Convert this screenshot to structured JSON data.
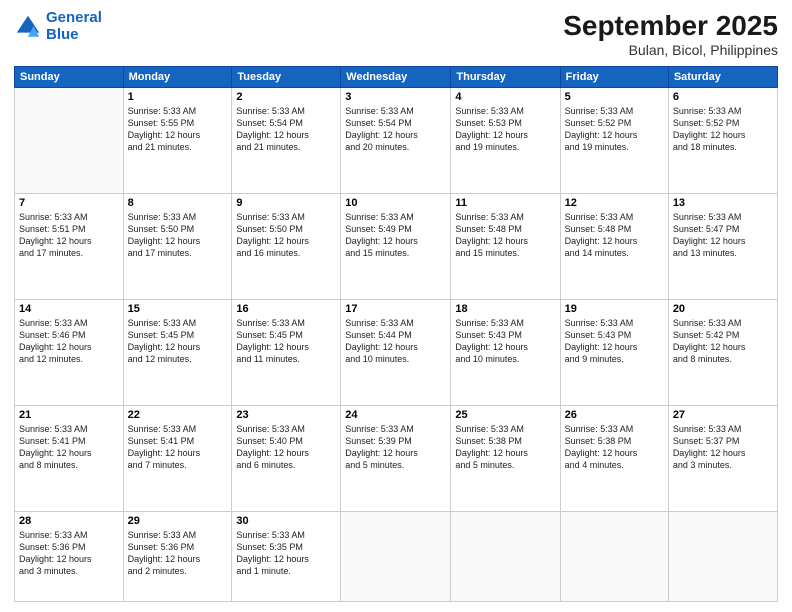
{
  "logo": {
    "line1": "General",
    "line2": "Blue"
  },
  "header": {
    "month": "September 2025",
    "location": "Bulan, Bicol, Philippines"
  },
  "weekdays": [
    "Sunday",
    "Monday",
    "Tuesday",
    "Wednesday",
    "Thursday",
    "Friday",
    "Saturday"
  ],
  "weeks": [
    [
      {
        "day": "",
        "text": ""
      },
      {
        "day": "1",
        "text": "Sunrise: 5:33 AM\nSunset: 5:55 PM\nDaylight: 12 hours\nand 21 minutes."
      },
      {
        "day": "2",
        "text": "Sunrise: 5:33 AM\nSunset: 5:54 PM\nDaylight: 12 hours\nand 21 minutes."
      },
      {
        "day": "3",
        "text": "Sunrise: 5:33 AM\nSunset: 5:54 PM\nDaylight: 12 hours\nand 20 minutes."
      },
      {
        "day": "4",
        "text": "Sunrise: 5:33 AM\nSunset: 5:53 PM\nDaylight: 12 hours\nand 19 minutes."
      },
      {
        "day": "5",
        "text": "Sunrise: 5:33 AM\nSunset: 5:52 PM\nDaylight: 12 hours\nand 19 minutes."
      },
      {
        "day": "6",
        "text": "Sunrise: 5:33 AM\nSunset: 5:52 PM\nDaylight: 12 hours\nand 18 minutes."
      }
    ],
    [
      {
        "day": "7",
        "text": "Sunrise: 5:33 AM\nSunset: 5:51 PM\nDaylight: 12 hours\nand 17 minutes."
      },
      {
        "day": "8",
        "text": "Sunrise: 5:33 AM\nSunset: 5:50 PM\nDaylight: 12 hours\nand 17 minutes."
      },
      {
        "day": "9",
        "text": "Sunrise: 5:33 AM\nSunset: 5:50 PM\nDaylight: 12 hours\nand 16 minutes."
      },
      {
        "day": "10",
        "text": "Sunrise: 5:33 AM\nSunset: 5:49 PM\nDaylight: 12 hours\nand 15 minutes."
      },
      {
        "day": "11",
        "text": "Sunrise: 5:33 AM\nSunset: 5:48 PM\nDaylight: 12 hours\nand 15 minutes."
      },
      {
        "day": "12",
        "text": "Sunrise: 5:33 AM\nSunset: 5:48 PM\nDaylight: 12 hours\nand 14 minutes."
      },
      {
        "day": "13",
        "text": "Sunrise: 5:33 AM\nSunset: 5:47 PM\nDaylight: 12 hours\nand 13 minutes."
      }
    ],
    [
      {
        "day": "14",
        "text": "Sunrise: 5:33 AM\nSunset: 5:46 PM\nDaylight: 12 hours\nand 12 minutes."
      },
      {
        "day": "15",
        "text": "Sunrise: 5:33 AM\nSunset: 5:45 PM\nDaylight: 12 hours\nand 12 minutes."
      },
      {
        "day": "16",
        "text": "Sunrise: 5:33 AM\nSunset: 5:45 PM\nDaylight: 12 hours\nand 11 minutes."
      },
      {
        "day": "17",
        "text": "Sunrise: 5:33 AM\nSunset: 5:44 PM\nDaylight: 12 hours\nand 10 minutes."
      },
      {
        "day": "18",
        "text": "Sunrise: 5:33 AM\nSunset: 5:43 PM\nDaylight: 12 hours\nand 10 minutes."
      },
      {
        "day": "19",
        "text": "Sunrise: 5:33 AM\nSunset: 5:43 PM\nDaylight: 12 hours\nand 9 minutes."
      },
      {
        "day": "20",
        "text": "Sunrise: 5:33 AM\nSunset: 5:42 PM\nDaylight: 12 hours\nand 8 minutes."
      }
    ],
    [
      {
        "day": "21",
        "text": "Sunrise: 5:33 AM\nSunset: 5:41 PM\nDaylight: 12 hours\nand 8 minutes."
      },
      {
        "day": "22",
        "text": "Sunrise: 5:33 AM\nSunset: 5:41 PM\nDaylight: 12 hours\nand 7 minutes."
      },
      {
        "day": "23",
        "text": "Sunrise: 5:33 AM\nSunset: 5:40 PM\nDaylight: 12 hours\nand 6 minutes."
      },
      {
        "day": "24",
        "text": "Sunrise: 5:33 AM\nSunset: 5:39 PM\nDaylight: 12 hours\nand 5 minutes."
      },
      {
        "day": "25",
        "text": "Sunrise: 5:33 AM\nSunset: 5:38 PM\nDaylight: 12 hours\nand 5 minutes."
      },
      {
        "day": "26",
        "text": "Sunrise: 5:33 AM\nSunset: 5:38 PM\nDaylight: 12 hours\nand 4 minutes."
      },
      {
        "day": "27",
        "text": "Sunrise: 5:33 AM\nSunset: 5:37 PM\nDaylight: 12 hours\nand 3 minutes."
      }
    ],
    [
      {
        "day": "28",
        "text": "Sunrise: 5:33 AM\nSunset: 5:36 PM\nDaylight: 12 hours\nand 3 minutes."
      },
      {
        "day": "29",
        "text": "Sunrise: 5:33 AM\nSunset: 5:36 PM\nDaylight: 12 hours\nand 2 minutes."
      },
      {
        "day": "30",
        "text": "Sunrise: 5:33 AM\nSunset: 5:35 PM\nDaylight: 12 hours\nand 1 minute."
      },
      {
        "day": "",
        "text": ""
      },
      {
        "day": "",
        "text": ""
      },
      {
        "day": "",
        "text": ""
      },
      {
        "day": "",
        "text": ""
      }
    ]
  ]
}
